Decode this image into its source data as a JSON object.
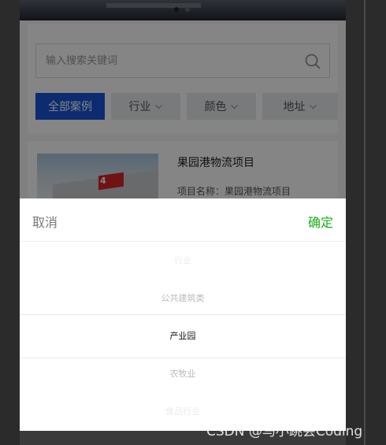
{
  "search": {
    "placeholder": "输入搜索关键词"
  },
  "filters": [
    {
      "label": "全部案例",
      "active": true
    },
    {
      "label": "行业",
      "active": false
    },
    {
      "label": "颜色",
      "active": false
    },
    {
      "label": "地址",
      "active": false
    }
  ],
  "result": {
    "title": "果园港物流项目",
    "description": "项目名称：果园港物流项目",
    "thumb_sign": "4"
  },
  "picker": {
    "cancel_label": "取消",
    "confirm_label": "确定",
    "options": [
      "行业",
      "公共建筑类",
      "产业园",
      "农牧业",
      "食品行业"
    ],
    "selected": "产业园"
  },
  "watermark": "CSDN @马小跳会Coding",
  "colors": {
    "accent_blue": "#1a55d6",
    "confirm_green": "#1aad19"
  },
  "icons": [
    "search-icon",
    "chevron-down-icon"
  ]
}
